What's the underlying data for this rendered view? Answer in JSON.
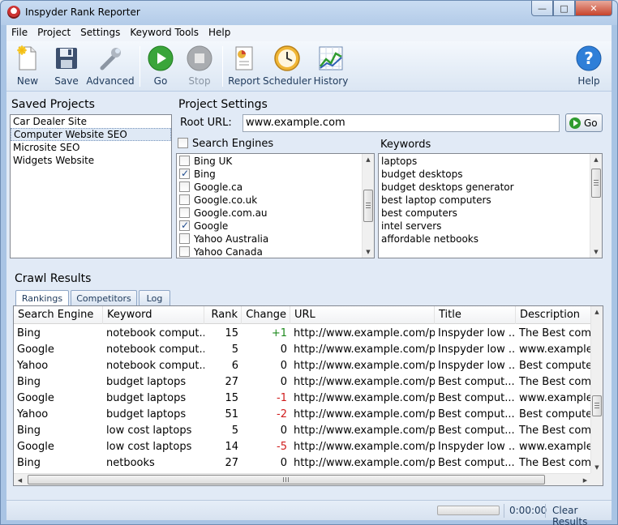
{
  "window": {
    "title": "Inspyder Rank Reporter",
    "controls": [
      "—",
      "□",
      "✕"
    ]
  },
  "menu": [
    "File",
    "Project",
    "Settings",
    "Keyword Tools",
    "Help"
  ],
  "toolbar": {
    "new": "New",
    "save": "Save",
    "advanced": "Advanced",
    "go": "Go",
    "stop": "Stop",
    "report": "Report",
    "scheduler": "Scheduler",
    "history": "History",
    "help": "Help"
  },
  "saved_projects": {
    "title": "Saved Projects",
    "items": [
      "Car Dealer Site",
      "Computer Website SEO",
      "Microsite SEO",
      "Widgets Website"
    ],
    "selected_index": 1
  },
  "project_settings": {
    "title": "Project Settings",
    "root_url_label": "Root URL:",
    "root_url_value": "www.example.com",
    "go_label": "Go",
    "search_engines_label": "Search Engines",
    "search_engines": [
      {
        "name": "Bing UK",
        "checked": false
      },
      {
        "name": "Bing",
        "checked": true
      },
      {
        "name": "Google.ca",
        "checked": false
      },
      {
        "name": "Google.co.uk",
        "checked": false
      },
      {
        "name": "Google.com.au",
        "checked": false
      },
      {
        "name": "Google",
        "checked": true
      },
      {
        "name": "Yahoo Australia",
        "checked": false
      },
      {
        "name": "Yahoo Canada",
        "checked": false
      }
    ],
    "keywords_label": "Keywords",
    "keywords": [
      "laptops",
      "budget desktops",
      "budget desktops generator",
      "best laptop computers",
      "best computers",
      "intel servers",
      "affordable netbooks"
    ]
  },
  "crawl_results": {
    "title": "Crawl Results",
    "tabs": [
      "Rankings",
      "Competitors",
      "Log"
    ],
    "active_tab": 0,
    "columns": [
      "Search Engine",
      "Keyword",
      "Rank",
      "Change",
      "URL",
      "Title",
      "Description"
    ],
    "rows": [
      [
        "Bing",
        "notebook comput...",
        "15",
        "+1",
        "http://www.example.com/p...",
        "Inspyder low ...",
        "The Best comp"
      ],
      [
        "Google",
        "notebook comput...",
        "5",
        "0",
        "http://www.example.com/p...",
        "Inspyder low ...",
        "www.example.co"
      ],
      [
        "Yahoo",
        "notebook comput...",
        "6",
        "0",
        "http://www.example.com/p...",
        "Inspyder low ...",
        "Best computer"
      ],
      [
        "Bing",
        "budget laptops",
        "27",
        "0",
        "http://www.example.com/p...",
        "Best comput...",
        "The Best comp"
      ],
      [
        "Google",
        "budget laptops",
        "15",
        "-1",
        "http://www.example.com/p...",
        "Best comput...",
        "www.example.co"
      ],
      [
        "Yahoo",
        "budget laptops",
        "51",
        "-2",
        "http://www.example.com/p...",
        "Best comput...",
        "Best computer"
      ],
      [
        "Bing",
        "low cost laptops",
        "5",
        "0",
        "http://www.example.com/p...",
        "Best comput...",
        "The Best comp"
      ],
      [
        "Google",
        "low cost laptops",
        "14",
        "-5",
        "http://www.example.com/p...",
        "Inspyder low ...",
        "www.example.co"
      ],
      [
        "Bing",
        "netbooks",
        "27",
        "0",
        "http://www.example.com/p...",
        "Best comput...",
        "The Best comp"
      ]
    ]
  },
  "status": {
    "progress": 0,
    "elapsed": "0:00:00",
    "clear_results": "Clear Results"
  },
  "colors": {
    "positive_change": "#1e8a1e",
    "negative_change": "#d01c1c",
    "accent": "#2f9b2f"
  }
}
